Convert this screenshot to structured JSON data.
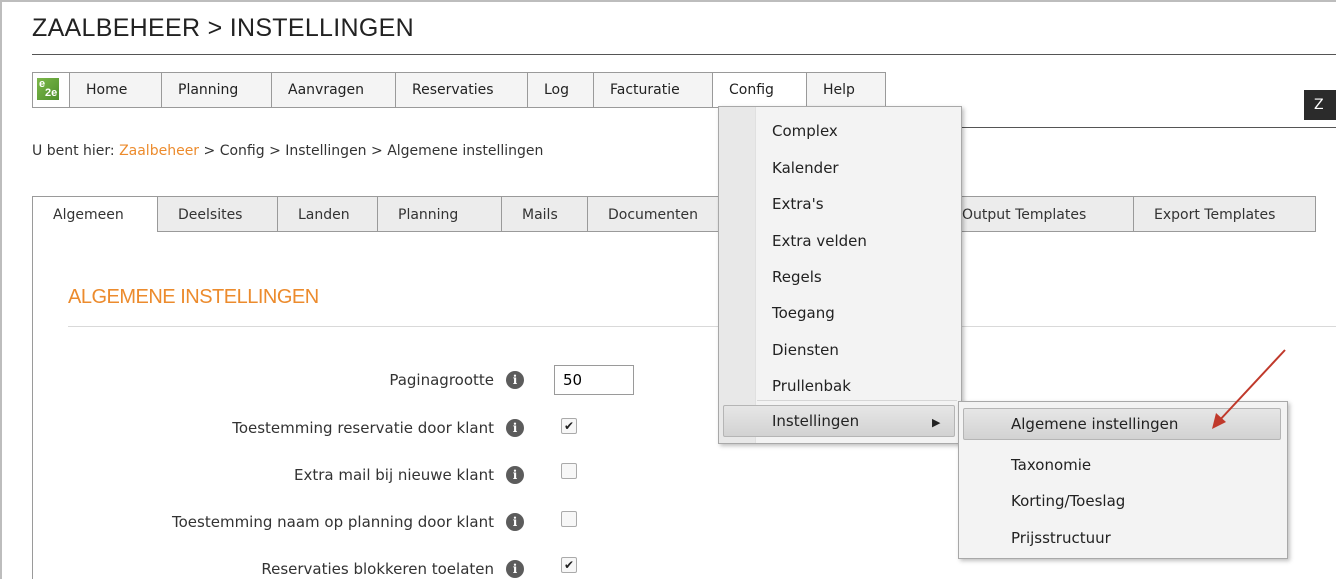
{
  "header": {
    "title": "ZAALBEHEER > INSTELLINGEN"
  },
  "logo": {
    "text_top": "e",
    "text_bottom": "2e"
  },
  "nav": {
    "items": [
      {
        "label": "Home"
      },
      {
        "label": "Planning"
      },
      {
        "label": "Aanvragen"
      },
      {
        "label": "Reservaties"
      },
      {
        "label": "Log"
      },
      {
        "label": "Facturatie"
      },
      {
        "label": "Config",
        "active": true
      },
      {
        "label": "Help"
      }
    ],
    "user_initial": "Z"
  },
  "breadcrumb": {
    "prefix": "U bent hier: ",
    "link": "Zaalbeheer",
    "rest": " > Config > Instellingen > Algemene instellingen"
  },
  "tabs": {
    "left": [
      "Algemeen",
      "Deelsites",
      "Landen",
      "Planning",
      "Mails",
      "Documenten"
    ],
    "right": [
      "Output Templates",
      "Export Templates"
    ]
  },
  "section": {
    "title": "ALGEMENE INSTELLINGEN"
  },
  "form": {
    "page_size": {
      "label": "Paginagrootte",
      "value": "50"
    },
    "rows": [
      {
        "label": "Toestemming reservatie door klant",
        "checked": true
      },
      {
        "label": "Extra mail bij nieuwe klant",
        "checked": false
      },
      {
        "label": "Toestemming naam op planning door klant",
        "checked": false
      },
      {
        "label": "Reservaties blokkeren toelaten",
        "checked": true
      }
    ],
    "info_glyph": "i",
    "check_glyph": "✔"
  },
  "config_menu": {
    "items": [
      "Complex",
      "Kalender",
      "Extra's",
      "Extra velden",
      "Regels",
      "Toegang",
      "Diensten",
      "Prullenbak"
    ],
    "submenu_parent": "Instellingen",
    "submenu_arrow": "▶"
  },
  "instellingen_submenu": {
    "items": [
      "Algemene instellingen",
      "Taxonomie",
      "Korting/Toeslag",
      "Prijsstructuur"
    ],
    "highlighted": "Algemene instellingen"
  },
  "colors": {
    "accent": "#ec8b2d",
    "annotation_arrow": "#c0392b"
  },
  "icons": {
    "info": "info-icon",
    "arrow": "chevron-right-icon",
    "checkbox": "checkbox"
  }
}
